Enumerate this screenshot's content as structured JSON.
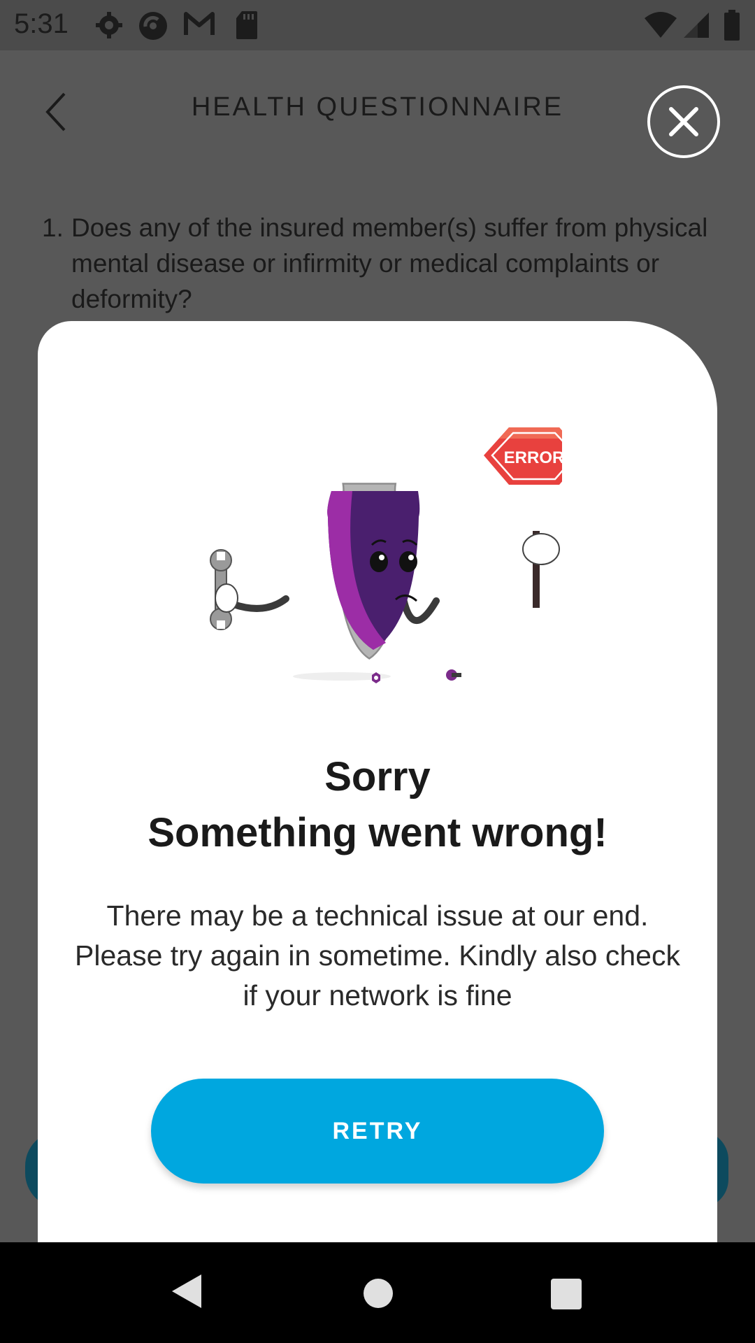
{
  "status_bar": {
    "time": "5:31",
    "icons_left": [
      "settings-icon",
      "sync-icon",
      "gmail-icon",
      "sd-card-icon"
    ],
    "icons_right": [
      "wifi-icon",
      "signal-icon",
      "battery-icon"
    ]
  },
  "header": {
    "title": "HEALTH QUESTIONNAIRE",
    "back_icon": "chevron-left-icon",
    "close_icon": "close-icon"
  },
  "question": {
    "number": "1.",
    "text": "Does any of the insured member(s) suffer from physical mental disease or infirmity or medical complaints or deformity?"
  },
  "error_modal": {
    "illustration_sign_text": "ERROR",
    "title_line1": "Sorry",
    "title_line2": "Something went wrong!",
    "message": "There may be a technical issue at our end. Please try again in sometime. Kindly also check if your network is fine",
    "retry_label": "RETRY"
  },
  "colors": {
    "accent": "#00a7df",
    "shield_purple": "#4a1f6e",
    "error_red": "#e8413e",
    "overlay": "#585858"
  },
  "nav_bar": {
    "icons": [
      "nav-back-icon",
      "nav-home-icon",
      "nav-recents-icon"
    ]
  }
}
